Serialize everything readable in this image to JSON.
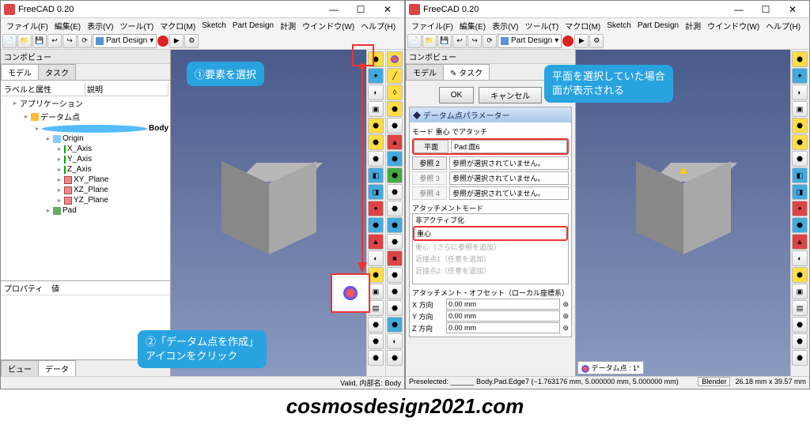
{
  "app_title": "FreeCAD 0.20",
  "menu": [
    "ファイル(F)",
    "編集(E)",
    "表示(V)",
    "ツール(T)",
    "マクロ(M)",
    "Sketch",
    "Part Design",
    "計測",
    "ウインドウ(W)",
    "ヘルプ(H)"
  ],
  "workbench": "Part Design",
  "combo_header": "コンボビュー",
  "tabs": {
    "model": "モデル",
    "task": "タスク"
  },
  "tree_hdr": {
    "col1": "ラベルと属性",
    "col2": "説明"
  },
  "tree": {
    "app": "アプリケーション",
    "doc": "データム点",
    "body": "Body",
    "origin": "Origin",
    "axes": [
      "X_Axis",
      "Y_Axis",
      "Z_Axis"
    ],
    "planes": [
      "XY_Plane",
      "XZ_Plane",
      "YZ_Plane"
    ],
    "pad": "Pad"
  },
  "prop": {
    "c1": "プロパティ",
    "c2": "値"
  },
  "bottom_tabs": [
    "ビュー",
    "データ"
  ],
  "status_left": "Valid, 内部名: Body",
  "status_right_pre": "Preselected: ______ Body.Pad.Edge7 (−1.763176 mm, 5.000000 mm, 5.000000 mm)",
  "status_right_dim": "26.18 mm x 39.57 mm",
  "status_blender": "Blender",
  "task": {
    "ok": "OK",
    "cancel": "キャンセル",
    "panel_title": "データム点パラメーター",
    "mode_line": "モード 重心 でアタッチ",
    "ref_labels": [
      "平面",
      "参照 2",
      "参照 3",
      "参照 4"
    ],
    "ref_vals": [
      "Pad:面6",
      "参照が選択されていません。",
      "参照が選択されていません。",
      "参照が選択されていません。"
    ],
    "att_label": "アタッチメントモード",
    "modes": [
      "非アクティブ化",
      "重心",
      "重心（さらに参照を追加）",
      "近接点1（任意を追加）",
      "近接点2（任意を追加）"
    ],
    "offset_label": "アタッチメント・オフセット（ローカル座標系）",
    "off_axes": [
      "X 方向",
      "Y 方向",
      "Z 方向"
    ],
    "off_val": "0.00 mm",
    "datum_status": "データム点 : 1*"
  },
  "callout1": "①要素を選択",
  "callout2a": "②「データム点を作成」",
  "callout2b": "アイコンをクリック",
  "callout3a": "平面を選択していた場合",
  "callout3b": "面が表示される",
  "footer": "cosmosdesign2021.com",
  "icons": [
    "📄",
    "📁",
    "💾",
    "↩",
    "↪",
    "🔍",
    "⚙",
    "📐",
    "🧊",
    "◧"
  ]
}
